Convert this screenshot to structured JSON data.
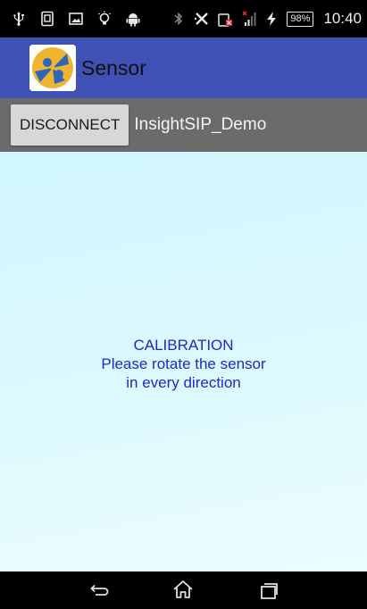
{
  "status_bar": {
    "icons_left": [
      "usb-icon",
      "sim-toolkit-icon",
      "image-icon",
      "lightbulb-icon",
      "android-icon"
    ],
    "icons_right": [
      "bluetooth-icon",
      "vibrate-off-icon",
      "no-sim-icon",
      "signal-icon",
      "charging-icon"
    ],
    "battery": "98%",
    "time": "10:40"
  },
  "app_bar": {
    "title": "Sensor",
    "color": "#3f51b5"
  },
  "connection": {
    "disconnect_label": "DISCONNECT",
    "device_name": "InsightSIP_Demo"
  },
  "calibration": {
    "line1": "CALIBRATION",
    "line2": "Please rotate the sensor",
    "line3": "in every direction",
    "color": "#1a2bc4"
  },
  "nav_bar": {
    "buttons": [
      "back-icon",
      "home-icon",
      "recents-icon"
    ]
  }
}
